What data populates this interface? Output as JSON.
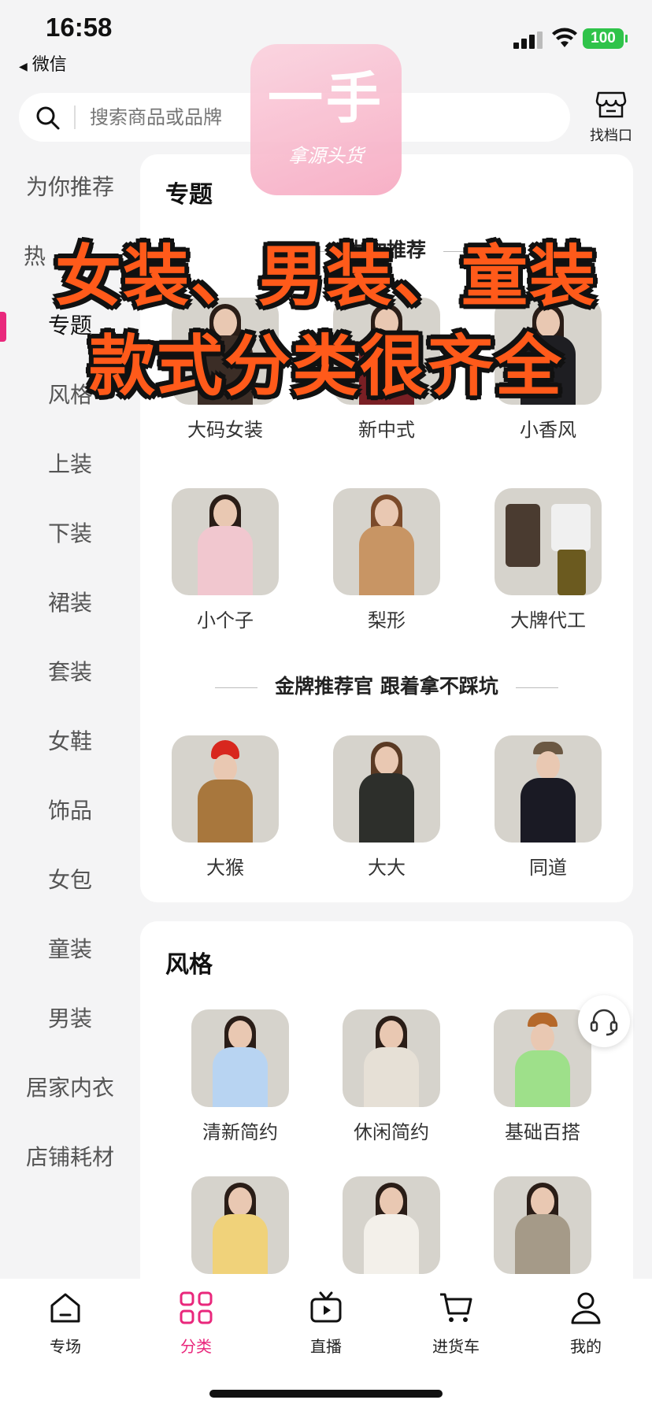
{
  "status_bar": {
    "time": "16:58",
    "back_app": "微信",
    "battery": "100"
  },
  "search": {
    "placeholder": "搜索商品或品牌",
    "stall_label": "找档口"
  },
  "logo": {
    "big": "一手",
    "small": "拿源头货"
  },
  "sidebar": {
    "items": [
      {
        "label": "为你推荐"
      },
      {
        "label": "热"
      },
      {
        "label": "专题"
      },
      {
        "label": "风格"
      },
      {
        "label": "上装"
      },
      {
        "label": "下装"
      },
      {
        "label": "裙装"
      },
      {
        "label": "套装"
      },
      {
        "label": "女鞋"
      },
      {
        "label": "饰品"
      },
      {
        "label": "女包"
      },
      {
        "label": "童装"
      },
      {
        "label": "男装"
      },
      {
        "label": "居家内衣"
      },
      {
        "label": "店铺耗材"
      }
    ],
    "active_color": "#e9287c"
  },
  "topics": {
    "title": "专题",
    "sub_header_1": "为你推荐",
    "row1": [
      {
        "name": "大码女装"
      },
      {
        "name": "新中式"
      },
      {
        "name": "小香风"
      }
    ],
    "row2": [
      {
        "name": "小个子"
      },
      {
        "name": "梨形"
      },
      {
        "name": "大牌代工"
      }
    ],
    "sub_header_2": "金牌推荐官 跟着拿不踩坑",
    "row3": [
      {
        "name": "大猴"
      },
      {
        "name": "大大"
      },
      {
        "name": "同道"
      }
    ]
  },
  "style": {
    "title": "风格",
    "row1": [
      {
        "name": "清新简约"
      },
      {
        "name": "休闲简约"
      },
      {
        "name": "基础百搭"
      }
    ]
  },
  "overlay": {
    "line1": "女装、男装、童装",
    "line2": "款式分类很齐全"
  },
  "tabbar": {
    "items": [
      {
        "label": "专场"
      },
      {
        "label": "分类"
      },
      {
        "label": "直播"
      },
      {
        "label": "进货车"
      },
      {
        "label": "我的"
      }
    ],
    "active_color": "#e9287c"
  }
}
